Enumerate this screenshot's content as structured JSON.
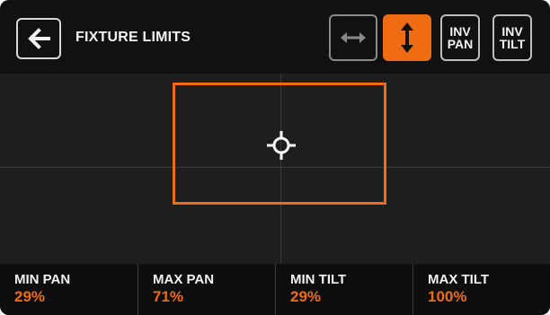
{
  "header": {
    "title": "FIXTURE LIMITS",
    "back_icon": "arrow-left-icon",
    "buttons": {
      "horizontal_icon": "arrow-horizontal-icon",
      "vertical_icon": "arrow-vertical-icon",
      "vertical_active": true,
      "inv_pan_line1": "INV",
      "inv_pan_line2": "PAN",
      "inv_tilt_line1": "INV",
      "inv_tilt_line2": "TILT"
    }
  },
  "area": {
    "crosshair_icon": "crosshair-icon"
  },
  "limits": [
    {
      "label": "MIN PAN",
      "value": "29%"
    },
    {
      "label": "MAX PAN",
      "value": "71%"
    },
    {
      "label": "MIN TILT",
      "value": "29%"
    },
    {
      "label": "MAX TILT",
      "value": "100%"
    }
  ],
  "colors": {
    "accent": "#ef6c12",
    "background": "#1b1b1b",
    "text": "#f2f2f2"
  }
}
